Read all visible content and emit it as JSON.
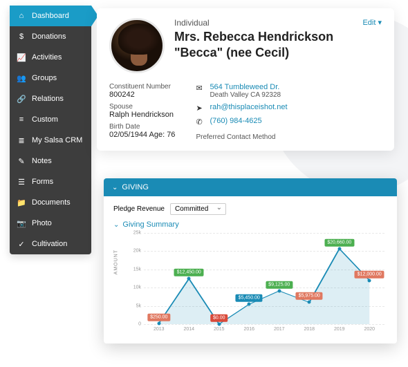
{
  "sidebar": {
    "items": [
      {
        "label": "Dashboard",
        "icon": "⌂"
      },
      {
        "label": "Donations",
        "icon": "$"
      },
      {
        "label": "Activities",
        "icon": "📈"
      },
      {
        "label": "Groups",
        "icon": "👥"
      },
      {
        "label": "Relations",
        "icon": "🔗"
      },
      {
        "label": "Custom",
        "icon": "≡"
      },
      {
        "label": "My Salsa CRM",
        "icon": "≣"
      },
      {
        "label": "Notes",
        "icon": "✎"
      },
      {
        "label": "Forms",
        "icon": "☰"
      },
      {
        "label": "Documents",
        "icon": "📁"
      },
      {
        "label": "Photo",
        "icon": "📷"
      },
      {
        "label": "Cultivation",
        "icon": "✓"
      }
    ]
  },
  "profile": {
    "edit": "Edit ▾",
    "type": "Individual",
    "name": "Mrs. Rebecca Hendrickson \"Becca\" (nee Cecil)",
    "constituent_label": "Constituent Number",
    "constituent_value": "800242",
    "spouse_label": "Spouse",
    "spouse_value": "Ralph Hendrickson",
    "birth_label": "Birth Date",
    "birth_value": "02/05/1944 Age: 76",
    "address_line1": "564 Tumbleweed Dr.",
    "address_line2": "Death Valley  CA  92328",
    "email": "rah@thisplaceishot.net",
    "phone": "(760) 984-4625",
    "preferred_label": "Preferred Contact Method"
  },
  "giving": {
    "header": "GIVING",
    "pledge_label": "Pledge Revenue",
    "pledge_value": "Committed",
    "summary_title": "Giving Summary",
    "ylabel": "AMOUNT"
  },
  "chart_data": {
    "type": "line",
    "xlabel": "",
    "ylabel": "AMOUNT",
    "ylim": [
      0,
      25000
    ],
    "yticks": [
      0,
      "5k",
      "10k",
      "15k",
      "20k",
      "25k"
    ],
    "categories": [
      "2013",
      "2014",
      "2015",
      "2016",
      "2017",
      "2018",
      "2019",
      "2020"
    ],
    "values": [
      250,
      12450,
      0,
      5450,
      9125,
      5975,
      20660,
      12000
    ],
    "labels": [
      "$250.00",
      "$12,450.00",
      "$0.00",
      "$5,450.00",
      "$9,125.00",
      "$5,975.00",
      "$20,660.00",
      "$12,000.00"
    ],
    "label_colors": [
      "#e07860",
      "#4caf50",
      "#d94a3a",
      "#1a8bb5",
      "#4caf50",
      "#e07860",
      "#4caf50",
      "#e07860"
    ]
  }
}
